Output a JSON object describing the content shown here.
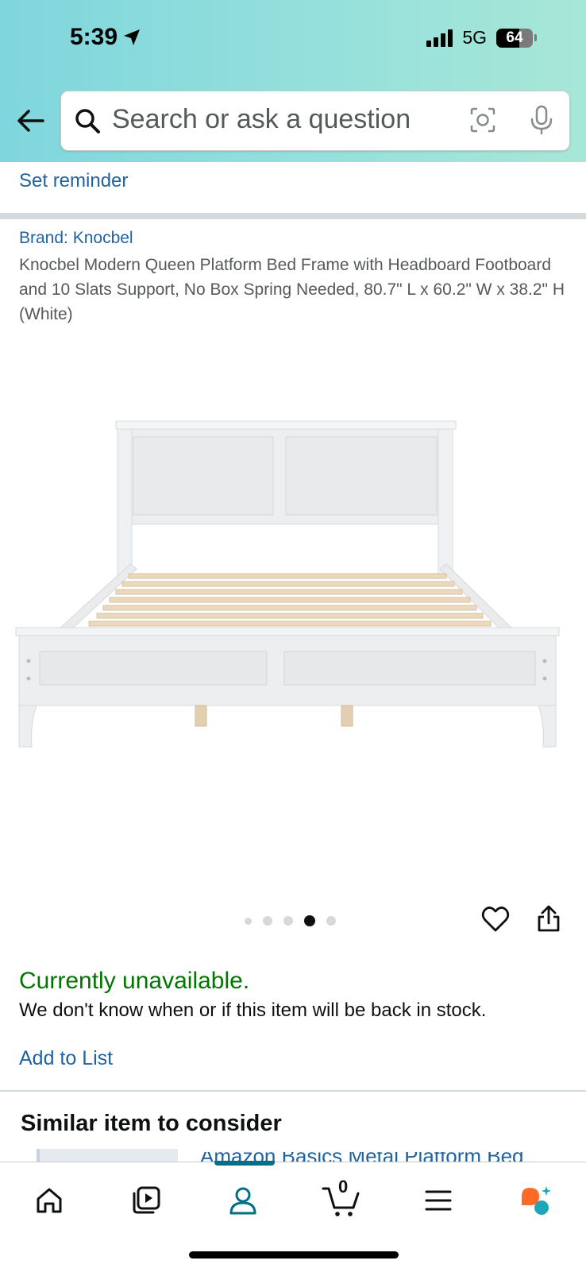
{
  "status_bar": {
    "time": "5:39",
    "network": "5G",
    "battery": "64",
    "battery_level": 0.64
  },
  "search": {
    "placeholder": "Search or ask a question"
  },
  "icons": {
    "back": "back-arrow-icon",
    "search": "search-icon",
    "lens": "camera-lens-icon",
    "mic": "microphone-icon",
    "heart": "heart-icon",
    "share": "share-icon",
    "nav": [
      "home-icon",
      "video-icon",
      "account-icon",
      "cart-icon",
      "menu-icon",
      "assistant-icon"
    ]
  },
  "reminder": {
    "label": "Set reminder"
  },
  "product": {
    "brand": "Brand: Knocbel",
    "title": "Knocbel Modern Queen Platform Bed Frame with Headboard Footboard and 10 Slats Support, No Box Spring Needed, 80.7\" L x 60.2\" W x 38.2\" H (White)",
    "image_count": 5,
    "active_image": 4
  },
  "availability": {
    "status": "Currently unavailable.",
    "message": "We don't know when or if this item will be back in stock."
  },
  "actions": {
    "add_to_list": "Add to List"
  },
  "similar": {
    "heading": "Similar item to consider",
    "item_title": "Amazon Basics Metal Platform Bed"
  },
  "bottom_nav": {
    "cart_count": "0",
    "active": "account"
  },
  "colors": {
    "link": "#2162a1",
    "available_green": "#007600",
    "nav_accent": "#007185",
    "assistant_orange": "#ff6a28",
    "assistant_teal": "#1fa6b8"
  }
}
